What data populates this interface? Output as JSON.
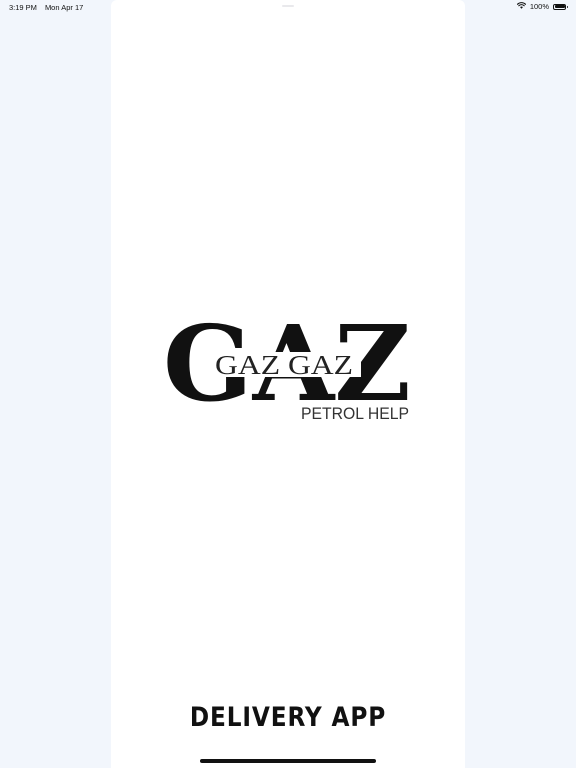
{
  "status_bar": {
    "time": "3:19 PM",
    "date": "Mon Apr 17",
    "battery": "100%",
    "battery_level": 1.0
  },
  "splash": {
    "logo_monogram": "GAZ",
    "logo_name": "GAZ GAZ",
    "logo_tagline": "PETROL HELP",
    "title": "DELIVERY APP"
  },
  "icons": {
    "wifi": "wifi-icon",
    "battery": "battery-icon"
  },
  "colors": {
    "background": "#f2f6fc",
    "panel": "#ffffff",
    "text": "#111111"
  }
}
